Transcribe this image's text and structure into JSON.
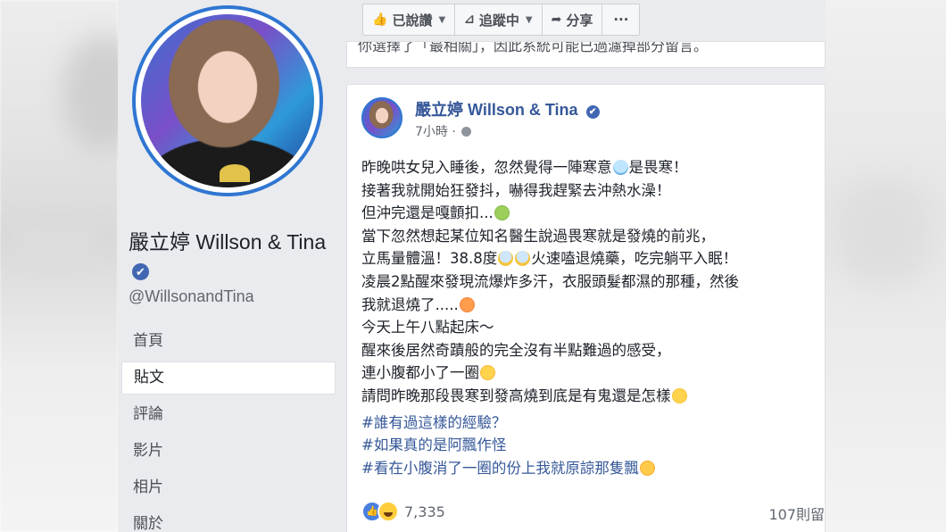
{
  "profile": {
    "name": "嚴立婷 Willson & Tina",
    "handle": "@WillsonandTina",
    "nav": [
      "首頁",
      "貼文",
      "評論",
      "影片",
      "相片",
      "關於"
    ],
    "active_nav": "貼文"
  },
  "actions": {
    "liked": "已說讚",
    "following": "追蹤中",
    "share": "分享",
    "more": "···"
  },
  "notice": "你選擇了「最相關」，因此系統可能已過濾掉部分留言。",
  "post": {
    "author": "嚴立婷 Willson & Tina",
    "time": "7小時 ·",
    "lines": [
      {
        "text": "昨晚哄女兒入睡後，忽然覺得一陣寒意",
        "emoji": "cold-face-emoji",
        "after": "是畏寒！"
      },
      {
        "text": "接著我就開始狂發抖，嚇得我趕緊去沖熱水澡！"
      },
      {
        "text": "但沖完還是嘎顫扣...",
        "emoji": "sick-face-emoji",
        "after": ""
      },
      {
        "text": "當下忽然想起某位知名醫生說過畏寒就是發燒的前兆，"
      },
      {
        "text": "立馬量體溫！38.8度",
        "emoji": "scream-face-emoji",
        "emoji2": "scream-face-emoji",
        "after": "火速嗑退燒藥，吃完躺平入眠！"
      },
      {
        "text": "凌晨2點醒來發現流爆炸多汗，衣服頭髮都濕的那種，然後"
      },
      {
        "text": "我就退燒了.....",
        "emoji": "hot-face-emoji",
        "after": ""
      },
      {
        "text": "今天上午八點起床～"
      },
      {
        "text": "醒來後居然奇蹟般的完全沒有半點難過的感受，"
      },
      {
        "text": "連小腹都小了一圈",
        "emoji": "surprised-face-emoji",
        "after": ""
      },
      {
        "text": "請問昨晚那段畏寒到發高燒到底是有鬼還是怎樣",
        "emoji": "eye-roll-face-emoji",
        "after": ""
      }
    ],
    "hashtags": [
      {
        "text": "#誰有過這樣的經驗？"
      },
      {
        "text": "#如果真的是阿飄作怪"
      },
      {
        "text": "#看在小腹消了一圈的份上我就原諒那隻飄",
        "emoji": "yum-face-emoji"
      }
    ],
    "reaction_count": "7,335",
    "comment_count": "107則留"
  },
  "icons": {
    "like": "thumbs-up-icon",
    "rss": "rss-icon",
    "share": "share-arrow-icon",
    "verified": "verified-badge-icon",
    "globe": "globe-icon"
  },
  "colors": {
    "link_blue": "#365899",
    "verified_blue": "#4267b2",
    "avatar_ring": "#2f76d2",
    "page_bg": "#e9ebee"
  }
}
